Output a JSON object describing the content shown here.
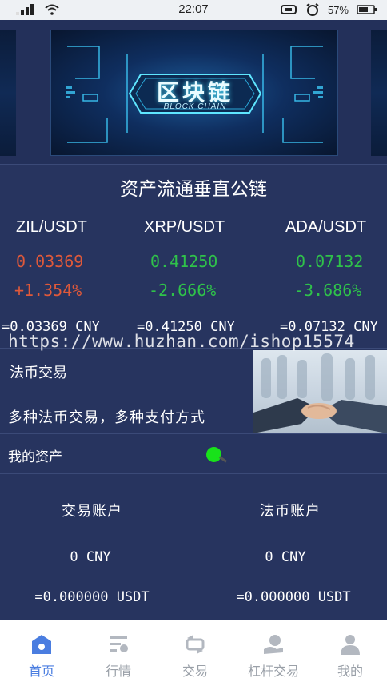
{
  "status_bar": {
    "time": "22:07",
    "battery": "57%"
  },
  "headline": "资产流通垂直公链",
  "banner": {
    "title": "区块链",
    "subtitle": "BLOCK CHAIN"
  },
  "tickers": [
    {
      "pair": "ZIL/USDT",
      "price": "0.03369",
      "change": "+1.354%",
      "cny": "=0.03369 CNY",
      "trend": "up"
    },
    {
      "pair": "XRP/USDT",
      "price": "0.41250",
      "change": "-2.666%",
      "cny": "=0.41250 CNY",
      "trend": "down"
    },
    {
      "pair": "ADA/USDT",
      "price": "0.07132",
      "change": "-3.686%",
      "cny": "=0.07132 CNY",
      "trend": "down"
    }
  ],
  "watermark": "https://www.huzhan.com/ishop15574",
  "fiat": {
    "title": "法币交易",
    "subtitle": "多种法币交易，多种支付方式"
  },
  "my_assets": {
    "label": "我的资产"
  },
  "accounts": [
    {
      "title": "交易账户",
      "cny": "0  CNY",
      "usdt": "=0.000000 USDT"
    },
    {
      "title": "法币账户",
      "cny": "0  CNY",
      "usdt": "=0.000000 USDT"
    }
  ],
  "tabs": [
    {
      "label": "首页",
      "icon": "home-icon",
      "active": true
    },
    {
      "label": "行情",
      "icon": "market-icon",
      "active": false
    },
    {
      "label": "交易",
      "icon": "trade-icon",
      "active": false
    },
    {
      "label": "杠杆交易",
      "icon": "leverage-icon",
      "active": false
    },
    {
      "label": "我的",
      "icon": "profile-icon",
      "active": false
    }
  ],
  "colors": {
    "background": "#27345f",
    "up": "#e0593a",
    "down": "#2fc24a",
    "active_tab": "#4a7de0",
    "inactive_tab": "#9aa0a8",
    "status_dot": "#18e21a"
  }
}
